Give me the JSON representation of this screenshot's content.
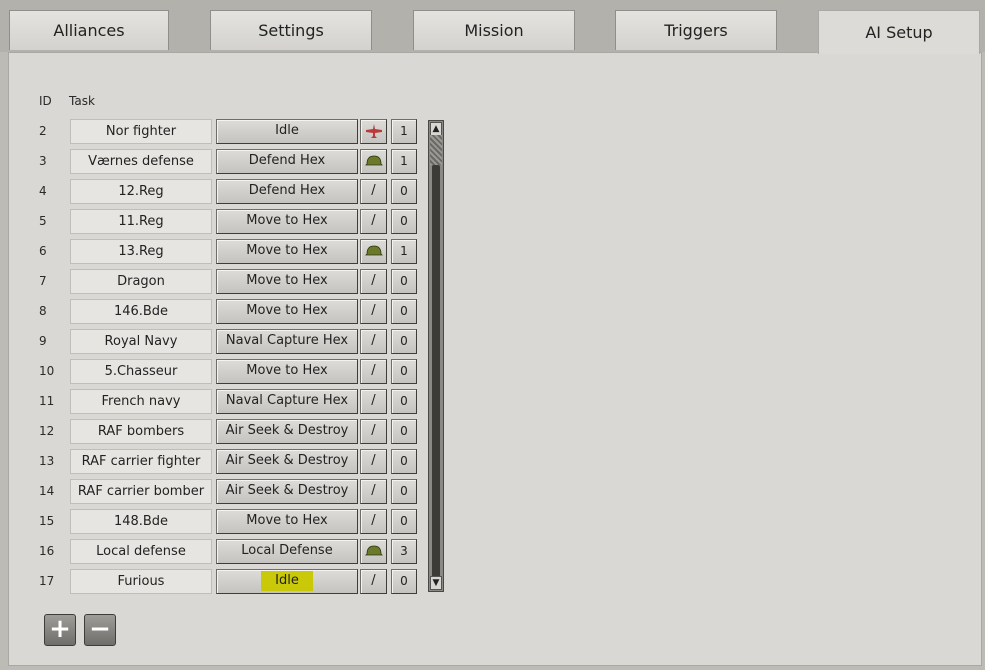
{
  "tabs": [
    {
      "label": "Alliances",
      "active": false
    },
    {
      "label": "Settings",
      "active": false
    },
    {
      "label": "Mission",
      "active": false
    },
    {
      "label": "Triggers",
      "active": false
    },
    {
      "label": "AI Setup",
      "active": true
    }
  ],
  "table": {
    "headers": {
      "id": "ID",
      "task": "Task"
    },
    "rows": [
      {
        "id": "2",
        "name": "Nor fighter",
        "task": "Idle",
        "unit": "plane-icon",
        "count": "1"
      },
      {
        "id": "3",
        "name": "Værnes defense",
        "task": "Defend Hex",
        "unit": "helmet-icon",
        "count": "1"
      },
      {
        "id": "4",
        "name": "12.Reg",
        "task": "Defend Hex",
        "unit": "/",
        "count": "0"
      },
      {
        "id": "5",
        "name": "11.Reg",
        "task": "Move to Hex",
        "unit": "/",
        "count": "0"
      },
      {
        "id": "6",
        "name": "13.Reg",
        "task": "Move to Hex",
        "unit": "helmet-icon",
        "count": "1"
      },
      {
        "id": "7",
        "name": "Dragon",
        "task": "Move to Hex",
        "unit": "/",
        "count": "0"
      },
      {
        "id": "8",
        "name": "146.Bde",
        "task": "Move to Hex",
        "unit": "/",
        "count": "0"
      },
      {
        "id": "9",
        "name": "Royal Navy",
        "task": "Naval Capture Hex",
        "unit": "/",
        "count": "0"
      },
      {
        "id": "10",
        "name": "5.Chasseur",
        "task": "Move to Hex",
        "unit": "/",
        "count": "0"
      },
      {
        "id": "11",
        "name": "French navy",
        "task": "Naval Capture Hex",
        "unit": "/",
        "count": "0"
      },
      {
        "id": "12",
        "name": "RAF bombers",
        "task": "Air Seek & Destroy",
        "unit": "/",
        "count": "0"
      },
      {
        "id": "13",
        "name": "RAF carrier fighter",
        "task": "Air Seek & Destroy",
        "unit": "/",
        "count": "0"
      },
      {
        "id": "14",
        "name": "RAF carrier bomber",
        "task": "Air Seek & Destroy",
        "unit": "/",
        "count": "0"
      },
      {
        "id": "15",
        "name": "148.Bde",
        "task": "Move to Hex",
        "unit": "/",
        "count": "0"
      },
      {
        "id": "16",
        "name": "Local defense",
        "task": "Local Defense",
        "unit": "helmet-icon",
        "count": "3"
      },
      {
        "id": "17",
        "name": "Furious",
        "task": "Idle",
        "unit": "/",
        "count": "0",
        "highlight": true
      }
    ]
  },
  "controls": {
    "add": "+",
    "remove": "−"
  },
  "colors": {
    "highlight": "#c9c90a",
    "helmet": "#6b7a2a",
    "plane": "#b83a3a"
  }
}
